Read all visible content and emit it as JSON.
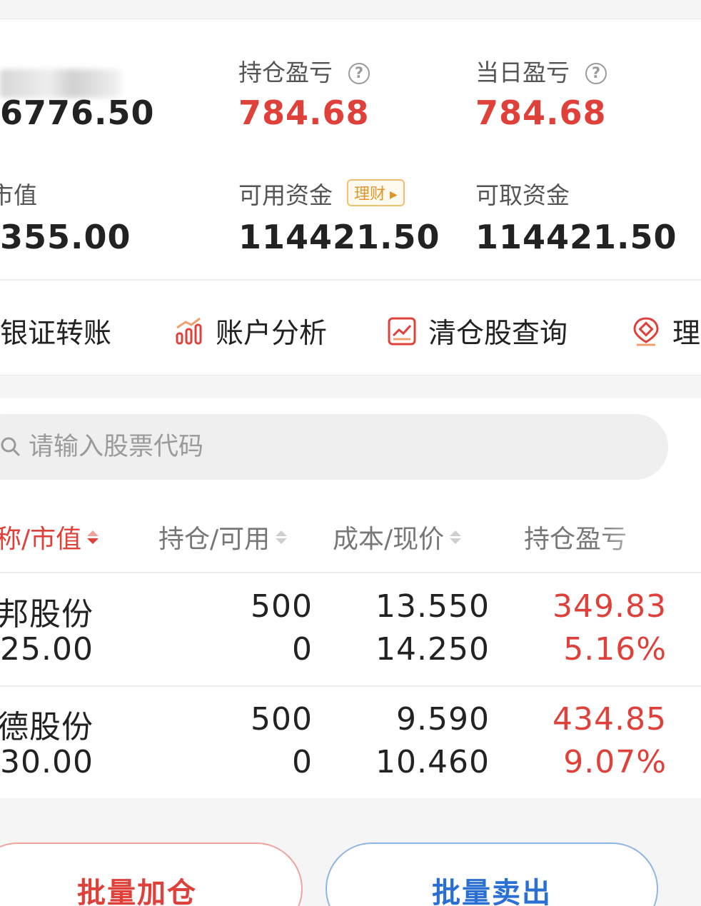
{
  "summary": {
    "total_assets_label": "",
    "total_assets_value": "6776.50",
    "position_pnl_label": "持仓盈亏",
    "position_pnl_value": "784.68",
    "daily_pnl_label": "当日盈亏",
    "daily_pnl_value": "784.68",
    "market_value_label": "市值",
    "market_value_value": "355.00",
    "available_funds_label": "可用资金",
    "available_funds_value": "114421.50",
    "licai_badge": "理财",
    "withdrawable_label": "可取资金",
    "withdrawable_value": "114421.50",
    "help_symbol": "?"
  },
  "quick_actions": [
    {
      "label": "银证转账",
      "icon": "transfer-icon"
    },
    {
      "label": "账户分析",
      "icon": "bar-chart-icon"
    },
    {
      "label": "清仓股查询",
      "icon": "trend-chart-icon"
    },
    {
      "label": "理",
      "icon": "location-coin-icon"
    }
  ],
  "search": {
    "placeholder": "请输入股票代码"
  },
  "table": {
    "headers": [
      "称/市值",
      "持仓/可用",
      "成本/现价",
      "持仓盈亏"
    ],
    "rows": [
      {
        "name": "邦股份",
        "market_value": "25.00",
        "position": "500",
        "available": "0",
        "cost": "13.550",
        "price": "14.250",
        "pnl": "349.83",
        "pnl_pct": "5.16%"
      },
      {
        "name": "德股份",
        "market_value": "30.00",
        "position": "500",
        "available": "0",
        "cost": "9.590",
        "price": "10.460",
        "pnl": "434.85",
        "pnl_pct": "9.07%"
      }
    ]
  },
  "buttons": {
    "batch_add": "批量加仓",
    "batch_sell": "批量卖出"
  },
  "colors": {
    "red": "#e0403a",
    "blue": "#2a6fd4",
    "orange": "#e0952a"
  }
}
